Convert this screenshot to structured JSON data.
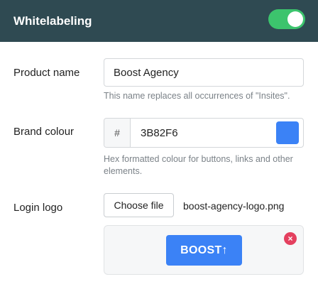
{
  "header": {
    "title": "Whitelabeling",
    "toggle_on": true
  },
  "product_name": {
    "label": "Product name",
    "value": "Boost Agency",
    "help": "This name replaces all occurrences of \"Insites\"."
  },
  "brand_colour": {
    "label": "Brand colour",
    "prefix": "#",
    "value": "3B82F6",
    "help": "Hex formatted colour for buttons, links and other elements."
  },
  "login_logo": {
    "label": "Login logo",
    "button_label": "Choose file",
    "file_name": "boost-agency-logo.png",
    "logo_text": "BOOST",
    "logo_arrow": "↑",
    "remove_glyph": "×"
  },
  "colors": {
    "header_bg": "#2f4a52",
    "toggle_on": "#3cc46d",
    "brand": "#3b82f6",
    "remove": "#e4405f"
  }
}
